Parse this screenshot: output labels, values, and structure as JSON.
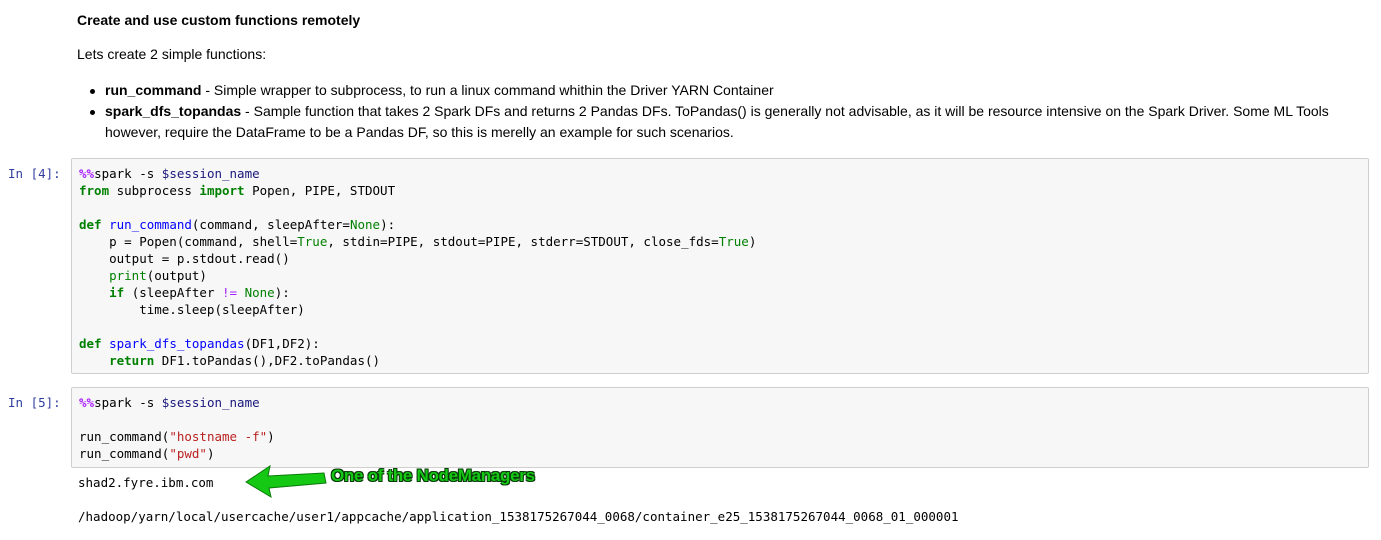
{
  "markdown": {
    "heading": "Create and use custom functions remotely",
    "intro": "Lets create 2 simple functions:",
    "items": [
      {
        "name": "run_command",
        "desc": " - Simple wrapper to subprocess, to run a linux command whithin the Driver YARN Container"
      },
      {
        "name": "spark_dfs_topandas",
        "desc": " - Sample function that takes 2 Spark DFs and returns 2 Pandas DFs. ToPandas() is generally not advisable, as it will be resource intensive on the Spark Driver. Some ML Tools however, require the DataFrame to be a Pandas DF, so this is merelly an example for such scenarios."
      }
    ]
  },
  "cells": [
    {
      "prompt": "In [4]:",
      "tokens": {
        "magic": "%%",
        "spark_s": "spark -s ",
        "var": "$session_name",
        "from": "from",
        "subprocess": " subprocess ",
        "import": "import",
        "import_names": " Popen, PIPE, STDOUT",
        "def1": "def",
        "fn1": "run_command",
        "sig1a": "(command, sleepAfter=",
        "None1": "None",
        "sig1b": "):",
        "l_p_a": "    p = Popen(command, shell=",
        "True1": "True",
        "l_p_b": ", stdin=PIPE, stdout=PIPE, stderr=STDOUT, close_fds=",
        "True2": "True",
        "l_p_c": ")",
        "l_out": "    output = p.stdout.read()",
        "print": "print",
        "print_arg": "(output)",
        "if": "if",
        "if_a": " (sleepAfter ",
        "neq": "!=",
        "None2": "None",
        "if_b": "):",
        "sleep": "        time.sleep(sleepAfter)",
        "def2": "def",
        "fn2": "spark_dfs_topandas",
        "sig2": "(DF1,DF2):",
        "return": "return",
        "ret_expr": " DF1.toPandas(),DF2.toPandas()"
      }
    },
    {
      "prompt": "In [5]:",
      "tokens": {
        "magic": "%%",
        "spark_s": "spark -s ",
        "var": "$session_name",
        "call1a": "run_command(",
        "str1": "\"hostname -f\"",
        "call1b": ")",
        "call2a": "run_command(",
        "str2": "\"pwd\"",
        "call2b": ")"
      }
    }
  ],
  "output": {
    "line1": "shad2.fyre.ibm.com",
    "line2": "/hadoop/yarn/local/usercache/user1/appcache/application_1538175267044_0068/container_e25_1538175267044_0068_01_000001"
  },
  "annotation": {
    "text": "One of the NodeManagers",
    "color": "#14c814"
  }
}
